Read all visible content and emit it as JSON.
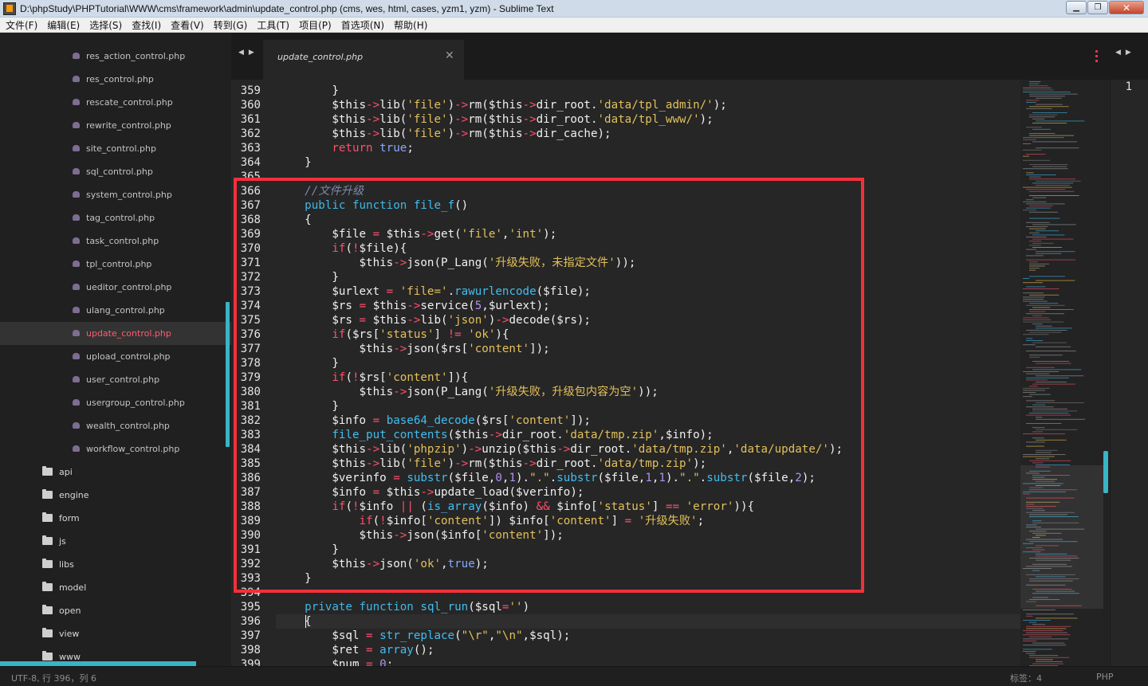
{
  "window": {
    "title": "D:\\phpStudy\\PHPTutorial\\WWW\\cms\\framework\\admin\\update_control.php (cms, wes, html, cases, yzm1, yzm) - Sublime Text",
    "min_glyph": "▁",
    "max_glyph": "❐",
    "close_glyph": "✕"
  },
  "menu": [
    "文件(F)",
    "编辑(E)",
    "选择(S)",
    "查找(I)",
    "查看(V)",
    "转到(G)",
    "工具(T)",
    "项目(P)",
    "首选项(N)",
    "帮助(H)"
  ],
  "sidebar": {
    "files": [
      "res_action_control.php",
      "res_control.php",
      "rescate_control.php",
      "rewrite_control.php",
      "site_control.php",
      "sql_control.php",
      "system_control.php",
      "tag_control.php",
      "task_control.php",
      "tpl_control.php",
      "ueditor_control.php",
      "ulang_control.php",
      "update_control.php",
      "upload_control.php",
      "user_control.php",
      "usergroup_control.php",
      "wealth_control.php",
      "workflow_control.php"
    ],
    "active_file_index": 12,
    "folders": [
      "api",
      "engine",
      "form",
      "js",
      "libs",
      "model",
      "open",
      "view",
      "www"
    ]
  },
  "tabbar": {
    "left_arrows": [
      "◀",
      "▶"
    ],
    "right_arrows": [
      "◀",
      "▶"
    ],
    "tab_label": "update_control.php",
    "tab_close": "✕"
  },
  "editor": {
    "first_line_number": 359,
    "current_line_number": 396,
    "lines": [
      [
        [
          "        }",
          ""
        ]
      ],
      [
        [
          "        $this",
          ""
        ],
        [
          "->",
          "op"
        ],
        [
          "lib(",
          ""
        ],
        [
          "'file'",
          "str"
        ],
        [
          ")",
          ""
        ],
        [
          "->",
          "op"
        ],
        [
          "rm($this",
          ""
        ],
        [
          "->",
          "op"
        ],
        [
          "dir_root.",
          ""
        ],
        [
          "'data/tpl_admin/'",
          "str"
        ],
        [
          ");",
          ""
        ]
      ],
      [
        [
          "        $this",
          ""
        ],
        [
          "->",
          "op"
        ],
        [
          "lib(",
          ""
        ],
        [
          "'file'",
          "str"
        ],
        [
          ")",
          ""
        ],
        [
          "->",
          "op"
        ],
        [
          "rm($this",
          ""
        ],
        [
          "->",
          "op"
        ],
        [
          "dir_root.",
          ""
        ],
        [
          "'data/tpl_www/'",
          "str"
        ],
        [
          ");",
          ""
        ]
      ],
      [
        [
          "        $this",
          ""
        ],
        [
          "->",
          "op"
        ],
        [
          "lib(",
          ""
        ],
        [
          "'file'",
          "str"
        ],
        [
          ")",
          ""
        ],
        [
          "->",
          "op"
        ],
        [
          "rm($this",
          ""
        ],
        [
          "->",
          "op"
        ],
        [
          "dir_cache);",
          ""
        ]
      ],
      [
        [
          "        ",
          ""
        ],
        [
          "return",
          "kw"
        ],
        [
          " ",
          ""
        ],
        [
          "true",
          "const"
        ],
        [
          ";",
          ""
        ]
      ],
      [
        [
          "    }",
          ""
        ]
      ],
      [
        [
          "",
          ""
        ]
      ],
      [
        [
          "    ",
          ""
        ],
        [
          "//文件升级",
          "cmt"
        ]
      ],
      [
        [
          "    ",
          ""
        ],
        [
          "public",
          "decl"
        ],
        [
          " ",
          ""
        ],
        [
          "function",
          "decl"
        ],
        [
          " ",
          ""
        ],
        [
          "file_f",
          "fn"
        ],
        [
          "()",
          ""
        ]
      ],
      [
        [
          "    {",
          ""
        ]
      ],
      [
        [
          "        $file ",
          ""
        ],
        [
          "=",
          "op"
        ],
        [
          " $this",
          ""
        ],
        [
          "->",
          "op"
        ],
        [
          "get(",
          ""
        ],
        [
          "'file'",
          "str"
        ],
        [
          ",",
          ""
        ],
        [
          "'int'",
          "str"
        ],
        [
          ");",
          ""
        ]
      ],
      [
        [
          "        ",
          ""
        ],
        [
          "if",
          "kw"
        ],
        [
          "(",
          ""
        ],
        [
          "!",
          "op"
        ],
        [
          "$file){",
          ""
        ]
      ],
      [
        [
          "            $this",
          ""
        ],
        [
          "->",
          "op"
        ],
        [
          "json(P_Lang(",
          ""
        ],
        [
          "'升级失败，未指定文件'",
          "str"
        ],
        [
          "));",
          ""
        ]
      ],
      [
        [
          "        }",
          ""
        ]
      ],
      [
        [
          "        $urlext ",
          ""
        ],
        [
          "=",
          "op"
        ],
        [
          " ",
          ""
        ],
        [
          "'file='",
          "str"
        ],
        [
          ".",
          ""
        ],
        [
          "rawurlencode",
          "fn"
        ],
        [
          "($file);",
          ""
        ]
      ],
      [
        [
          "        $rs ",
          ""
        ],
        [
          "=",
          "op"
        ],
        [
          " $this",
          ""
        ],
        [
          "->",
          "op"
        ],
        [
          "service(",
          ""
        ],
        [
          "5",
          "num"
        ],
        [
          ",$urlext);",
          ""
        ]
      ],
      [
        [
          "        $rs ",
          ""
        ],
        [
          "=",
          "op"
        ],
        [
          " $this",
          ""
        ],
        [
          "->",
          "op"
        ],
        [
          "lib(",
          ""
        ],
        [
          "'json'",
          "str"
        ],
        [
          ")",
          ""
        ],
        [
          "->",
          "op"
        ],
        [
          "decode($rs);",
          ""
        ]
      ],
      [
        [
          "        ",
          ""
        ],
        [
          "if",
          "kw"
        ],
        [
          "($rs[",
          ""
        ],
        [
          "'status'",
          "str"
        ],
        [
          "] ",
          ""
        ],
        [
          "!=",
          "op"
        ],
        [
          " ",
          ""
        ],
        [
          "'ok'",
          "str"
        ],
        [
          "){",
          ""
        ]
      ],
      [
        [
          "            $this",
          ""
        ],
        [
          "->",
          "op"
        ],
        [
          "json($rs[",
          ""
        ],
        [
          "'content'",
          "str"
        ],
        [
          "]);",
          ""
        ]
      ],
      [
        [
          "        }",
          ""
        ]
      ],
      [
        [
          "        ",
          ""
        ],
        [
          "if",
          "kw"
        ],
        [
          "(",
          ""
        ],
        [
          "!",
          "op"
        ],
        [
          "$rs[",
          ""
        ],
        [
          "'content'",
          "str"
        ],
        [
          "]){",
          ""
        ]
      ],
      [
        [
          "            $this",
          ""
        ],
        [
          "->",
          "op"
        ],
        [
          "json(P_Lang(",
          ""
        ],
        [
          "'升级失败，升级包内容为空'",
          "str"
        ],
        [
          "));",
          ""
        ]
      ],
      [
        [
          "        }",
          ""
        ]
      ],
      [
        [
          "        $info ",
          ""
        ],
        [
          "=",
          "op"
        ],
        [
          " ",
          ""
        ],
        [
          "base64_decode",
          "fn"
        ],
        [
          "($rs[",
          ""
        ],
        [
          "'content'",
          "str"
        ],
        [
          "]);",
          ""
        ]
      ],
      [
        [
          "        ",
          ""
        ],
        [
          "file_put_contents",
          "fn"
        ],
        [
          "($this",
          ""
        ],
        [
          "->",
          "op"
        ],
        [
          "dir_root.",
          ""
        ],
        [
          "'data/tmp.zip'",
          "str"
        ],
        [
          ",$info);",
          ""
        ]
      ],
      [
        [
          "        $this",
          ""
        ],
        [
          "->",
          "op"
        ],
        [
          "lib(",
          ""
        ],
        [
          "'phpzip'",
          "str"
        ],
        [
          ")",
          ""
        ],
        [
          "->",
          "op"
        ],
        [
          "unzip($this",
          ""
        ],
        [
          "->",
          "op"
        ],
        [
          "dir_root.",
          ""
        ],
        [
          "'data/tmp.zip'",
          "str"
        ],
        [
          ",",
          ""
        ],
        [
          "'data/update/'",
          "str"
        ],
        [
          ");",
          ""
        ]
      ],
      [
        [
          "        $this",
          ""
        ],
        [
          "->",
          "op"
        ],
        [
          "lib(",
          ""
        ],
        [
          "'file'",
          "str"
        ],
        [
          ")",
          ""
        ],
        [
          "->",
          "op"
        ],
        [
          "rm($this",
          ""
        ],
        [
          "->",
          "op"
        ],
        [
          "dir_root.",
          ""
        ],
        [
          "'data/tmp.zip'",
          "str"
        ],
        [
          ");",
          ""
        ]
      ],
      [
        [
          "        $verinfo ",
          ""
        ],
        [
          "=",
          "op"
        ],
        [
          " ",
          ""
        ],
        [
          "substr",
          "fn"
        ],
        [
          "($file,",
          ""
        ],
        [
          "0",
          "num"
        ],
        [
          ",",
          ""
        ],
        [
          "1",
          "num"
        ],
        [
          ").",
          ""
        ],
        [
          "\".\"",
          "str"
        ],
        [
          ".",
          ""
        ],
        [
          "substr",
          "fn"
        ],
        [
          "($file,",
          ""
        ],
        [
          "1",
          "num"
        ],
        [
          ",",
          ""
        ],
        [
          "1",
          "num"
        ],
        [
          ").",
          ""
        ],
        [
          "\".\"",
          "str"
        ],
        [
          ".",
          ""
        ],
        [
          "substr",
          "fn"
        ],
        [
          "($file,",
          ""
        ],
        [
          "2",
          "num"
        ],
        [
          ");",
          ""
        ]
      ],
      [
        [
          "        $info ",
          ""
        ],
        [
          "=",
          "op"
        ],
        [
          " $this",
          ""
        ],
        [
          "->",
          "op"
        ],
        [
          "update_load($verinfo);",
          ""
        ]
      ],
      [
        [
          "        ",
          ""
        ],
        [
          "if",
          "kw"
        ],
        [
          "(",
          ""
        ],
        [
          "!",
          "op"
        ],
        [
          "$info ",
          ""
        ],
        [
          "||",
          "op"
        ],
        [
          " (",
          ""
        ],
        [
          "is_array",
          "fn"
        ],
        [
          "($info) ",
          ""
        ],
        [
          "&&",
          "op"
        ],
        [
          " $info[",
          ""
        ],
        [
          "'status'",
          "str"
        ],
        [
          "] ",
          ""
        ],
        [
          "==",
          "op"
        ],
        [
          " ",
          ""
        ],
        [
          "'error'",
          "str"
        ],
        [
          ")){",
          ""
        ]
      ],
      [
        [
          "            ",
          ""
        ],
        [
          "if",
          "kw"
        ],
        [
          "(",
          ""
        ],
        [
          "!",
          "op"
        ],
        [
          "$info[",
          ""
        ],
        [
          "'content'",
          "str"
        ],
        [
          "]) $info[",
          ""
        ],
        [
          "'content'",
          "str"
        ],
        [
          "] ",
          ""
        ],
        [
          "=",
          "op"
        ],
        [
          " ",
          ""
        ],
        [
          "'升级失败'",
          "str"
        ],
        [
          ";",
          ""
        ]
      ],
      [
        [
          "            $this",
          ""
        ],
        [
          "->",
          "op"
        ],
        [
          "json($info[",
          ""
        ],
        [
          "'content'",
          "str"
        ],
        [
          "]);",
          ""
        ]
      ],
      [
        [
          "        }",
          ""
        ]
      ],
      [
        [
          "        $this",
          ""
        ],
        [
          "->",
          "op"
        ],
        [
          "json(",
          ""
        ],
        [
          "'ok'",
          "str"
        ],
        [
          ",",
          ""
        ],
        [
          "true",
          "const"
        ],
        [
          ");",
          ""
        ]
      ],
      [
        [
          "    }",
          ""
        ]
      ],
      [
        [
          "",
          ""
        ]
      ],
      [
        [
          "    ",
          ""
        ],
        [
          "private",
          "decl"
        ],
        [
          " ",
          ""
        ],
        [
          "function",
          "decl"
        ],
        [
          " ",
          ""
        ],
        [
          "sql_run",
          "fn"
        ],
        [
          "($sql",
          ""
        ],
        [
          "=",
          "op"
        ],
        [
          "",
          ""
        ],
        [
          "''",
          "str"
        ],
        [
          ")",
          ""
        ]
      ],
      [
        [
          "    {",
          ""
        ]
      ],
      [
        [
          "        $sql ",
          ""
        ],
        [
          "=",
          "op"
        ],
        [
          " ",
          ""
        ],
        [
          "str_replace",
          "fn"
        ],
        [
          "(",
          ""
        ],
        [
          "\"\\r\"",
          "str"
        ],
        [
          ",",
          ""
        ],
        [
          "\"\\n\"",
          "str"
        ],
        [
          ",$sql);",
          ""
        ]
      ],
      [
        [
          "        $ret ",
          ""
        ],
        [
          "=",
          "op"
        ],
        [
          " ",
          ""
        ],
        [
          "array",
          "fn"
        ],
        [
          "();",
          ""
        ]
      ],
      [
        [
          "        $num ",
          ""
        ],
        [
          "=",
          "op"
        ],
        [
          " ",
          ""
        ],
        [
          "0",
          "num"
        ],
        [
          ";",
          ""
        ]
      ]
    ],
    "split_pane_line": "1"
  },
  "colors": {
    "background": "#262626",
    "highlight_box": "#f2303b",
    "accent": "#3ab4c7"
  },
  "status": {
    "left": "UTF-8, 行 396，列 6",
    "tabs": "标签：4",
    "syntax": "PHP"
  }
}
